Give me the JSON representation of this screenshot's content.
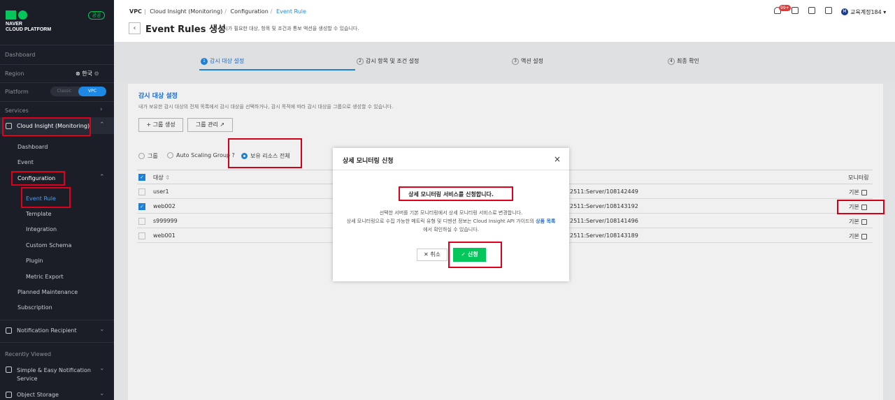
{
  "sidebar": {
    "logo_line1": "NAVER",
    "logo_line2": "CLOUD PLATFORM",
    "badge": "공공",
    "dashboard": "Dashboard",
    "region_label": "Region",
    "region_value": "한국",
    "platform_label": "Platform",
    "platform_classic": "Classic",
    "platform_vpc": "VPC",
    "services_label": "Services",
    "cloud_insight": "Cloud Insight (Monitoring)",
    "ci_items": {
      "dashboard": "Dashboard",
      "event": "Event",
      "configuration": "Configuration",
      "event_rule": "Event Rule",
      "template": "Template",
      "integration": "Integration",
      "custom_schema": "Custom Schema",
      "plugin": "Plugin",
      "metric_export": "Metric Export",
      "planned_maintenance": "Planned Maintenance",
      "subscription": "Subscription"
    },
    "notification_recipient": "Notification Recipient",
    "recently_viewed": "Recently Viewed",
    "recent1": "Simple & Easy Notification Service",
    "recent2": "Object Storage"
  },
  "header": {
    "breadcrumb": [
      "VPC",
      "Cloud Insight (Monitoring)",
      "Configuration",
      "Event Rule"
    ],
    "title": "Event Rules 생성",
    "description": "감시가 필요한 대상, 항목 및 조건과 통보 액션을 생성할 수 있습니다.",
    "notif_count": "99+",
    "user_initial": "M",
    "user_name": "교육계정184"
  },
  "steps": [
    {
      "num": "1",
      "label": "감시 대상 설정"
    },
    {
      "num": "2",
      "label": "감시 항목 및 조건 설정"
    },
    {
      "num": "3",
      "label": "액션 설정"
    },
    {
      "num": "4",
      "label": "최종 확인"
    }
  ],
  "section": {
    "title": "감시 대상 설정",
    "desc": "내가 보유한 감시 대상의 전체 목록에서 감시 대상을 선택하거나, 감시 목적에 따라 감시 대상을 그룹으로 생성할 수 있습니다.",
    "btn_create_group": "+ 그룹 생성",
    "btn_manage_group": "그룹 관리",
    "radio_group": "그룹",
    "radio_asg": "Auto Scaling Group",
    "radio_all": "보유 리소스 전체"
  },
  "table": {
    "col_target": "대상",
    "col_monitoring": "모니터링",
    "rows": [
      {
        "target": "user1",
        "id": "2511:Server/108142449",
        "monitoring": "기본",
        "checked": false
      },
      {
        "target": "web002",
        "id": "2511:Server/108143192",
        "monitoring": "기본",
        "checked": true
      },
      {
        "target": "s999999",
        "id": "2511:Server/108141496",
        "monitoring": "기본",
        "checked": false
      },
      {
        "target": "web001",
        "id": "2511:Server/108143189",
        "monitoring": "기본",
        "checked": false
      }
    ]
  },
  "modal": {
    "title": "상세 모니터링 신청",
    "close": "×",
    "headline": "상세 모니터링 서비스를 신청합니다.",
    "body1": "선택한 서버를 기본 모니터링에서 상세 모니터링 서비스로 변경합니다.",
    "body2": "상세 모니터링으로 수집 가능한 메트릭 유형 및 디멘션 정보는 Cloud Insight API 가이드의",
    "body_link": "상품 목록",
    "body3": "에서 확인하실 수 있습니다.",
    "cancel": "✕ 취소",
    "apply": "✓ 신청"
  },
  "colors": {
    "accent": "#1e88e5",
    "brand_green": "#03c75a",
    "highlight_red": "#e0001b",
    "sidebar_bg": "#1b1e27"
  }
}
